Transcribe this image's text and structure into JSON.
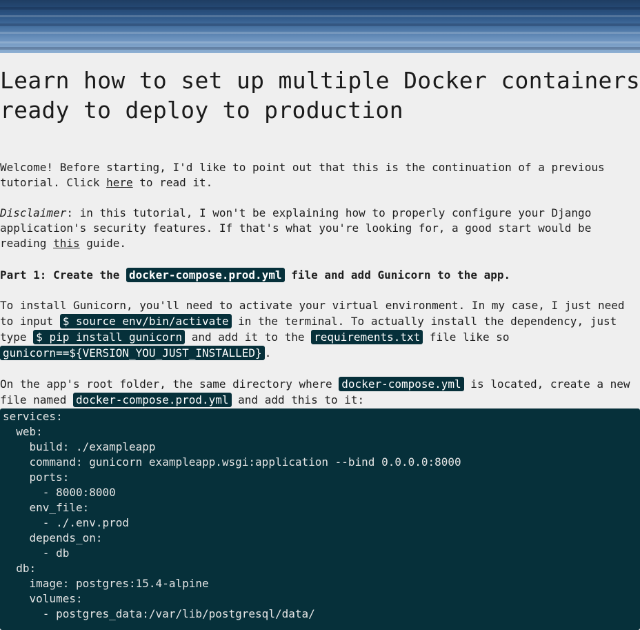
{
  "title": "Learn how to set up multiple Docker containers ready to deploy to production",
  "intro": {
    "before_link": "Welcome! Before starting, I'd like to point out that this is the continuation of a previous tutorial. Click ",
    "link": "here",
    "after_link": " to read it."
  },
  "disclaimer": {
    "label": "Disclaimer",
    "text_before": ": in this tutorial, I won't be explaining how to properly configure your Django application's security features. If that's what you're looking for, a good start would be reading ",
    "link": "this",
    "text_after": " guide."
  },
  "part1": {
    "before": "Part 1: Create the ",
    "code": "docker-compose.prod.yml",
    "after": " file and add Gunicorn to the app."
  },
  "install": {
    "t1": "To install Gunicorn, you'll need to activate your virtual environment. In my case, I just need to input ",
    "c1": "$ source env/bin/activate",
    "t2": " in the terminal. To actually install the dependency, just type ",
    "c2": "$ pip install gunicorn",
    "t3": " and add it to the ",
    "c3": "requirements.txt",
    "t4": " file like so ",
    "c4": "gunicorn==${VERSION_YOU_JUST_INSTALLED}",
    "t5": "."
  },
  "compose": {
    "t1": "On the app's root folder, the same directory where ",
    "c1": "docker-compose.yml",
    "t2": " is located, create a new file named ",
    "c2": "docker-compose.prod.yml",
    "t3": " and add this to it:"
  },
  "code_block": "services:\n  web:\n    build: ./exampleapp\n    command: gunicorn exampleapp.wsgi:application --bind 0.0.0.0:8000\n    ports:\n      - 8000:8000\n    env_file:\n      - ./.env.prod\n    depends_on:\n      - db\n  db:\n    image: postgres:15.4-alpine\n    volumes:\n      - postgres_data:/var/lib/postgresql/data/"
}
